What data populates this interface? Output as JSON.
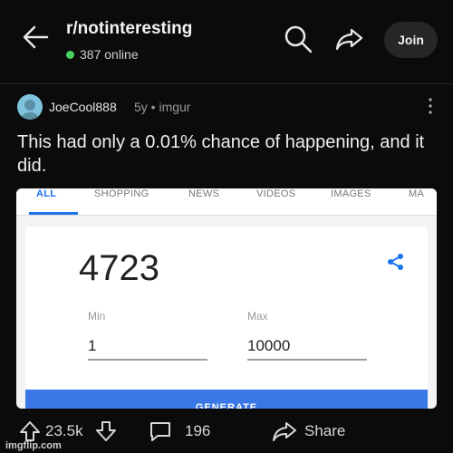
{
  "header": {
    "subreddit": "r/notinteresting",
    "online": "387 online",
    "join_label": "Join"
  },
  "post": {
    "author": "JoeCool888",
    "meta": "5y • imgur",
    "title": "This had only a 0.01% chance of happening, and it did."
  },
  "embed": {
    "tabs": [
      "ALL",
      "SHOPPING",
      "NEWS",
      "VIDEOS",
      "IMAGES",
      "MA"
    ],
    "result": "4723",
    "min_label": "Min",
    "max_label": "Max",
    "min_value": "1",
    "max_value": "10000",
    "generate_label": "GENERATE"
  },
  "actions": {
    "votes": "23.5k",
    "comments": "196",
    "share_label": "Share"
  },
  "watermark": "imgflip.com",
  "colors": {
    "background": "#0b0b0b",
    "online_dot": "#46d160",
    "google_blue": "#1a73e8",
    "generate_button": "#3b78e7"
  }
}
